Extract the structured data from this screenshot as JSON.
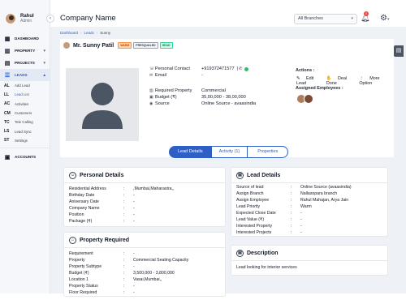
{
  "user": {
    "name": "Rahul",
    "role": "Admin"
  },
  "sidebar": {
    "items": [
      {
        "label": "DASHBOARD",
        "icon": "dashboard-icon",
        "glyph": "▦"
      },
      {
        "label": "PROPERTY",
        "icon": "building-icon",
        "glyph": "▥",
        "chevron": "▾"
      },
      {
        "label": "PROJECTS",
        "icon": "projects-icon",
        "glyph": "▤",
        "chevron": "▾"
      },
      {
        "label": "LEADS",
        "icon": "leads-icon",
        "glyph": "☰",
        "chevron": "▴"
      }
    ],
    "sub_items": [
      {
        "abbr": "AL",
        "label": "Add Lead"
      },
      {
        "abbr": "LL",
        "label": "Lead List"
      },
      {
        "abbr": "AC",
        "label": "Activities"
      },
      {
        "abbr": "CM",
        "label": "Customers"
      },
      {
        "abbr": "TC",
        "label": "Tele Calling"
      },
      {
        "abbr": "LS",
        "label": "Lead Sync"
      },
      {
        "abbr": "ST",
        "label": "Settings"
      }
    ],
    "accounts": {
      "label": "ACCOUNTS",
      "icon": "accounts-icon",
      "glyph": "▣"
    }
  },
  "header": {
    "company": "Company Name",
    "branch_select": "All Branches",
    "notification_count": "0"
  },
  "breadcrumb": {
    "home": "Dashboard",
    "section": "Leads",
    "current": "Sunny"
  },
  "lead": {
    "name": "Mr. Sunny Patil",
    "tags": [
      "WARM",
      "PRESQUALED",
      "HEAD"
    ],
    "personal_contact_label": "Personal Contact",
    "personal_contact": "+919372471577",
    "email_label": "Email",
    "email": "-",
    "required_property_label": "Required Property",
    "required_property": "Commercial",
    "budget_label": "Budget (₹)",
    "budget": "35,00,000 - 38,00,000",
    "source_label": "Source",
    "source": "Online Source - avaasindia"
  },
  "actions": {
    "title": "Actions :",
    "edit": "Edit Lead",
    "deal": "Deal Done",
    "more": "More Option",
    "assigned_title": "Assigned Employees :"
  },
  "tabs": [
    "Lead Details",
    "Activity (1)",
    "Properties"
  ],
  "personal_details": {
    "title": "Personal Details",
    "rows": [
      {
        "k": "Residential Address",
        "v": ",Mumbai,Maharastra,,"
      },
      {
        "k": "Birthday Date",
        "v": "-"
      },
      {
        "k": "Aniversary Date",
        "v": "-"
      },
      {
        "k": "Company Name",
        "v": "-"
      },
      {
        "k": "Position",
        "v": "-"
      },
      {
        "k": "Package (₹)",
        "v": "-"
      }
    ]
  },
  "lead_details": {
    "title": "Lead Details",
    "rows": [
      {
        "k": "Source of lead",
        "v": "Online Source (avaasindia)"
      },
      {
        "k": "Assign Branch",
        "v": "Nallasopara branch"
      },
      {
        "k": "Assign Employee",
        "v": "Rahul Mahajan, Arya Jain"
      },
      {
        "k": "Lead Priority",
        "v": "Warm"
      },
      {
        "k": "Expected Close Date",
        "v": "-"
      },
      {
        "k": "Lead Value (₹)",
        "v": "-"
      },
      {
        "k": "Interested Property",
        "v": "-"
      },
      {
        "k": "Interested Projects",
        "v": "-"
      }
    ]
  },
  "property_required": {
    "title": "Property Required",
    "rows": [
      {
        "k": "Requirement",
        "v": "-"
      },
      {
        "k": "Property",
        "v": "Commercial Seating Capacity"
      },
      {
        "k": "Property Subtype",
        "v": "-"
      },
      {
        "k": "Budget (₹)",
        "v": "3,500,000 - 3,800,000"
      },
      {
        "k": "Location 1",
        "v": "Vasai,Mumbai,,"
      },
      {
        "k": "Property Status",
        "v": "-"
      },
      {
        "k": "Floor Required",
        "v": "-"
      }
    ]
  },
  "description": {
    "title": "Description",
    "text": "Lead looking for interior services"
  },
  "colors": {
    "accent": "#2f5fc4",
    "sidebar_bg": "#f6f7fa",
    "content_bg": "#eef1f6"
  }
}
